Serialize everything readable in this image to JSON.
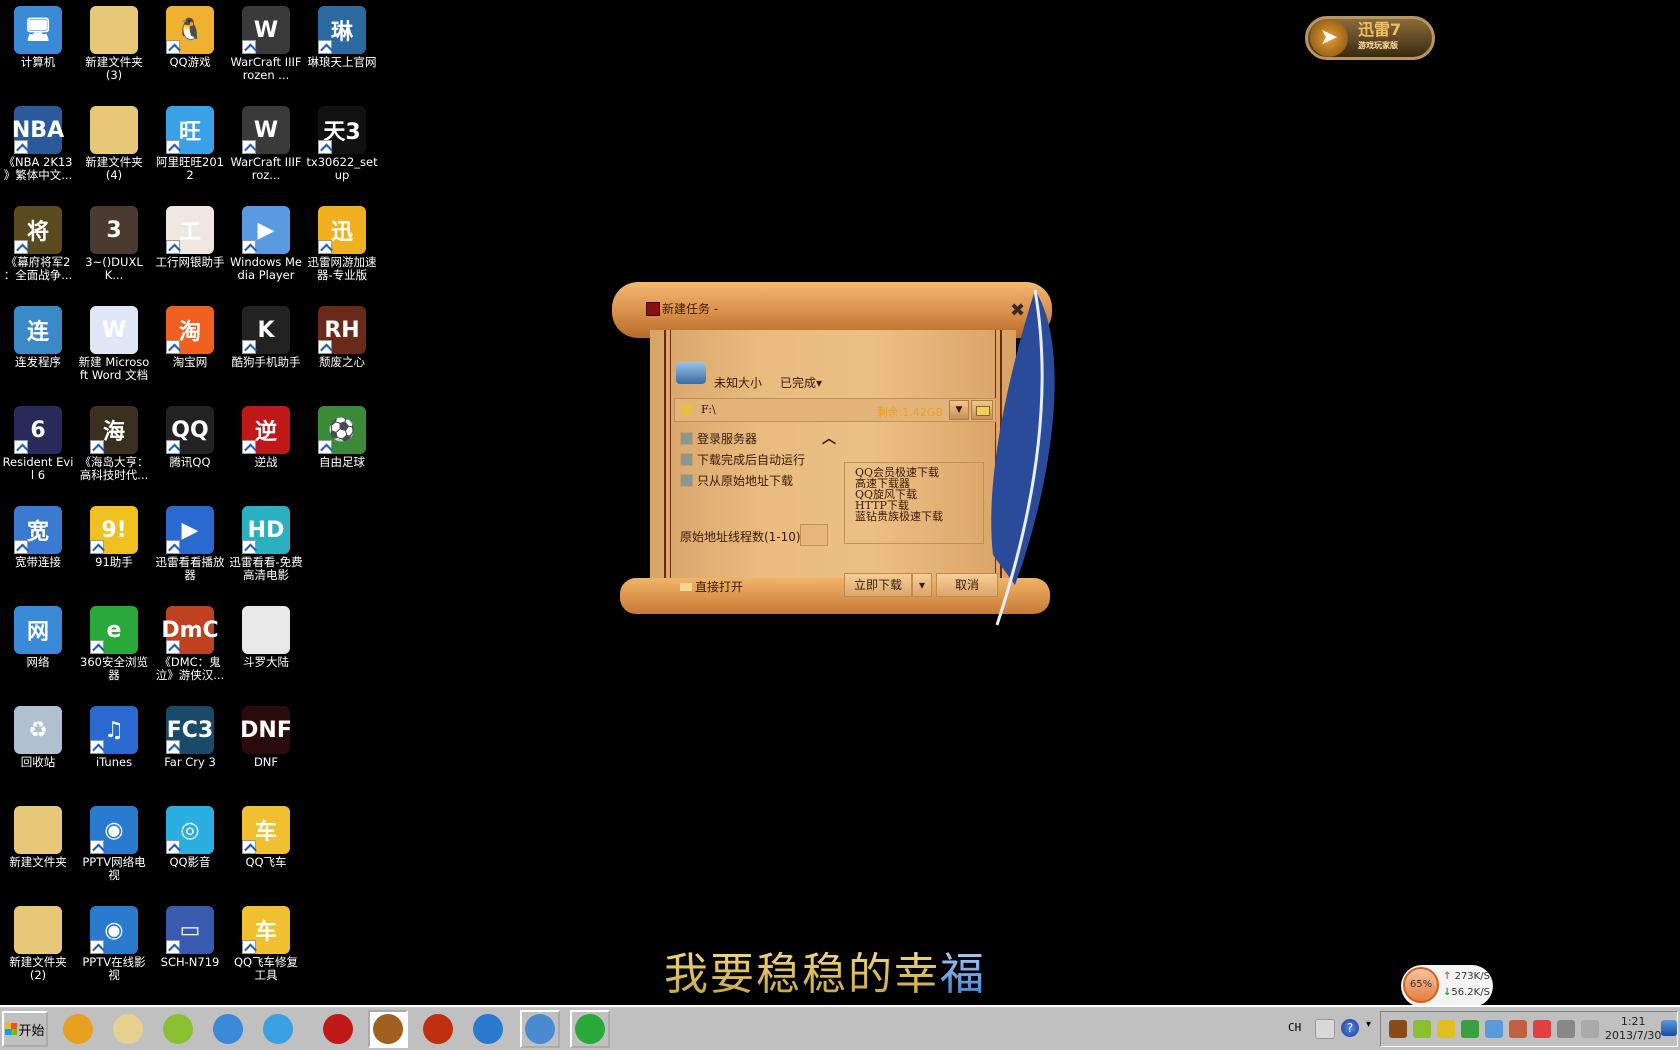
{
  "desktop": {
    "icons": [
      {
        "label": "计算机",
        "color": "#3a8ad8",
        "glyph": "🖥",
        "shortcut": false
      },
      {
        "label": "新建文件夹 (3)",
        "color": "#e6c878",
        "glyph": "",
        "shortcut": false
      },
      {
        "label": "QQ游戏",
        "color": "#f0b030",
        "glyph": "🐧",
        "shortcut": true
      },
      {
        "label": "WarCraft IIIFrozen ...",
        "color": "#3a3a3a",
        "glyph": "W",
        "shortcut": true
      },
      {
        "label": "琳琅天上官网",
        "color": "#2a6aa0",
        "glyph": "琳",
        "shortcut": true
      },
      {
        "label": "《NBA 2K13 》繁体中文...",
        "color": "#2a5a9a",
        "glyph": "NBA",
        "shortcut": true
      },
      {
        "label": "新建文件夹 (4)",
        "color": "#e6c878",
        "glyph": "",
        "shortcut": false
      },
      {
        "label": "阿里旺旺2012",
        "color": "#3aa0e8",
        "glyph": "旺",
        "shortcut": true
      },
      {
        "label": "WarCraft IIIFroz...",
        "color": "#3a3a3a",
        "glyph": "W",
        "shortcut": true
      },
      {
        "label": "tx30622_setup",
        "color": "#111111",
        "glyph": "天3",
        "shortcut": true
      },
      {
        "label": "《幕府将军2 ：全面战争...",
        "color": "#5a4a20",
        "glyph": "将",
        "shortcut": true
      },
      {
        "label": "3~()DUXLK...",
        "color": "#4a3a30",
        "glyph": "3",
        "shortcut": false
      },
      {
        "label": "工行网银助手",
        "color": "#f0e8e0",
        "glyph": "工",
        "shortcut": true
      },
      {
        "label": "Windows Media Player",
        "color": "#5a9ae0",
        "glyph": "▶",
        "shortcut": true
      },
      {
        "label": "迅雷网游加速器-专业版",
        "color": "#f0b020",
        "glyph": "迅",
        "shortcut": true
      },
      {
        "label": "连发程序",
        "color": "#3a8ac8",
        "glyph": "连",
        "shortcut": false
      },
      {
        "label": "新建 Microsoft Word 文档",
        "color": "#e0e8f8",
        "glyph": "W",
        "shortcut": false
      },
      {
        "label": "淘宝网",
        "color": "#f06020",
        "glyph": "淘",
        "shortcut": true
      },
      {
        "label": "酷狗手机助手",
        "color": "#222222",
        "glyph": "K",
        "shortcut": true
      },
      {
        "label": "颓废之心",
        "color": "#6a2a1a",
        "glyph": "RH",
        "shortcut": true
      },
      {
        "label": "Resident Evil 6",
        "color": "#2a2a5a",
        "glyph": "6",
        "shortcut": true
      },
      {
        "label": "《海岛大亨：高科技时代...",
        "color": "#3a3020",
        "glyph": "海",
        "shortcut": true
      },
      {
        "label": "腾讯QQ",
        "color": "#222222",
        "glyph": "QQ",
        "shortcut": true
      },
      {
        "label": "逆战",
        "color": "#c01818",
        "glyph": "逆",
        "shortcut": true
      },
      {
        "label": "自由足球",
        "color": "#3a8a3a",
        "glyph": "⚽",
        "shortcut": true
      },
      {
        "label": "宽带连接",
        "color": "#3a7ad0",
        "glyph": "宽",
        "shortcut": true
      },
      {
        "label": "91助手",
        "color": "#f0c020",
        "glyph": "9!",
        "shortcut": true
      },
      {
        "label": "迅雷看看播放器",
        "color": "#2a6ad0",
        "glyph": "▶",
        "shortcut": true
      },
      {
        "label": "迅雷看看-免费高清电影",
        "color": "#2ab0c0",
        "glyph": "HD",
        "shortcut": true
      },
      null,
      {
        "label": "网络",
        "color": "#3a8ad8",
        "glyph": "网",
        "shortcut": false
      },
      {
        "label": "360安全浏览器",
        "color": "#2aa83a",
        "glyph": "e",
        "shortcut": true
      },
      {
        "label": "《DMC：鬼泣》游侠汉...",
        "color": "#c04020",
        "glyph": "DmC",
        "shortcut": true
      },
      {
        "label": "斗罗大陆",
        "color": "#e8e8e8",
        "glyph": "",
        "shortcut": false
      },
      null,
      {
        "label": "回收站",
        "color": "#b0c0d0",
        "glyph": "♻",
        "shortcut": false
      },
      {
        "label": "iTunes",
        "color": "#2a6ad0",
        "glyph": "♫",
        "shortcut": true
      },
      {
        "label": "Far Cry 3",
        "color": "#1a4a6a",
        "glyph": "FC3",
        "shortcut": true
      },
      {
        "label": "DNF",
        "color": "#2a0a0a",
        "glyph": "DNF",
        "shortcut": false
      },
      null,
      {
        "label": "新建文件夹",
        "color": "#e6c878",
        "glyph": "",
        "shortcut": false
      },
      {
        "label": "PPTV网络电视",
        "color": "#2a7ad0",
        "glyph": "◉",
        "shortcut": true
      },
      {
        "label": "QQ影音",
        "color": "#2ab0e0",
        "glyph": "◎",
        "shortcut": true
      },
      {
        "label": "QQ飞车",
        "color": "#f0c030",
        "glyph": "车",
        "shortcut": true
      },
      null,
      {
        "label": "新建文件夹 (2)",
        "color": "#e6c878",
        "glyph": "",
        "shortcut": false
      },
      {
        "label": "PPTV在线影视",
        "color": "#2a7ad0",
        "glyph": "◉",
        "shortcut": true
      },
      {
        "label": "SCH-N719",
        "color": "#3a5ab0",
        "glyph": "▭",
        "shortcut": true
      },
      {
        "label": "QQ飞车修复工具",
        "color": "#f0c030",
        "glyph": "车",
        "shortcut": true
      },
      null
    ]
  },
  "widgets": {
    "xunlei_logo": {
      "title": "迅雷7",
      "subtitle": "游戏玩家版"
    },
    "lyric": {
      "text": "我要稳稳的幸",
      "last_char": "福"
    },
    "net_monitor": {
      "percent": "65%",
      "upload": "273K/S",
      "download": "56.2K/S"
    }
  },
  "dialog": {
    "title": "新建任务 -",
    "close_glyph": "✖",
    "file_size": "未知大小",
    "status_dropdown": "已完成▾",
    "save_path": "F:\\",
    "free_space": "剩余:1.42GB",
    "collapse_glyph": "︿",
    "options": [
      {
        "label": "登录服务器",
        "checked": false
      },
      {
        "label": "下载完成后自动运行",
        "checked": false
      },
      {
        "label": "只从原始地址下载",
        "checked": false
      }
    ],
    "threads_label": "原始地址线程数(1-10)",
    "threads_value": "",
    "download_modes": [
      "QQ会员极速下载",
      "高速下载器",
      "QQ旋风下载",
      "HTTP下载",
      "蓝钻贵族极速下载"
    ],
    "open_directly": "直接打开",
    "download_now": "立即下载",
    "download_dropdown": "▾",
    "cancel": "取消"
  },
  "taskbar": {
    "start_label": "开始",
    "apps": [
      {
        "name": "360-launcher",
        "color": "#e8a020"
      },
      {
        "name": "file-explorer",
        "color": "#e8d090"
      },
      {
        "name": "music-player",
        "color": "#8ac030"
      },
      {
        "name": "xunlei-kankan",
        "color": "#3a8ad8"
      },
      {
        "name": "uploader",
        "color": "#3aa0e0"
      },
      {
        "name": "nizhan",
        "color": "#c01818"
      },
      {
        "name": "xunlei",
        "color": "#a06020"
      },
      {
        "name": "dnf",
        "color": "#c03010"
      },
      {
        "name": "pptv",
        "color": "#2a7ad0"
      },
      {
        "name": "control-panel",
        "color": "#4a8ad0"
      },
      {
        "name": "ie-360",
        "color": "#2aa83a"
      }
    ],
    "ime": "CH",
    "clock_time": "1:21",
    "clock_date": "2013/7/30",
    "tray_icons": [
      "bird",
      "music",
      "plus",
      "shield",
      "display",
      "users",
      "flag-error",
      "network",
      "volume"
    ]
  }
}
